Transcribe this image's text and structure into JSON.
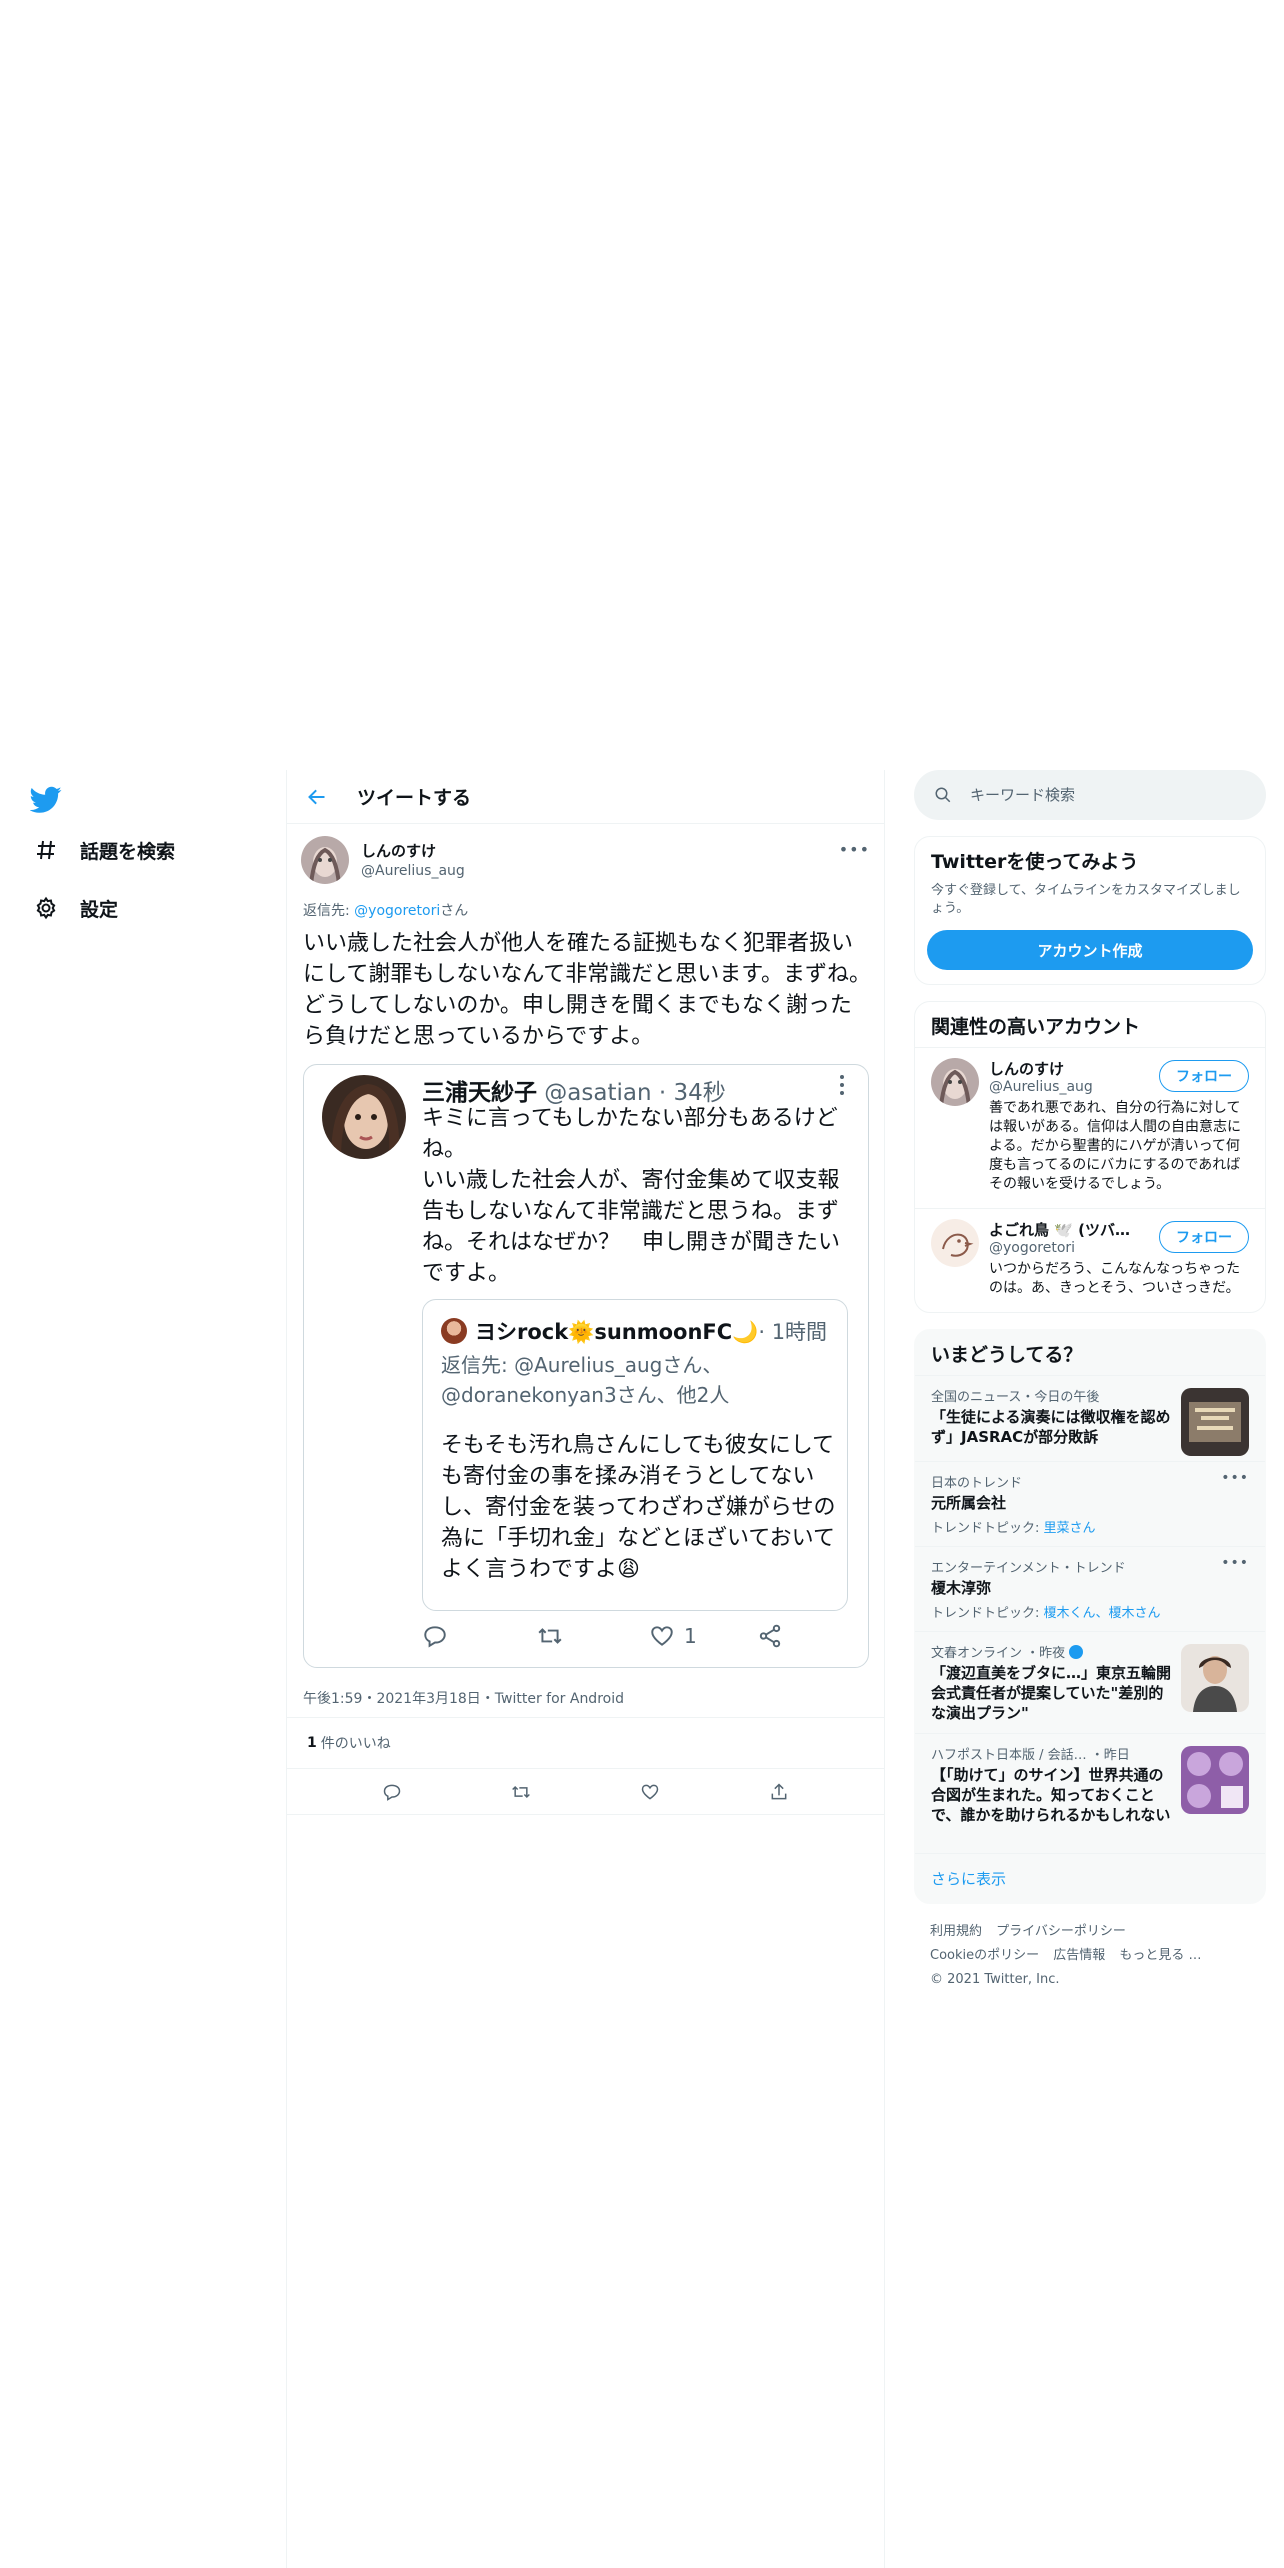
{
  "nav": {
    "items": [
      {
        "label": "話題を検索",
        "icon": "hashtag-icon"
      },
      {
        "label": "設定",
        "icon": "gear-icon"
      }
    ]
  },
  "header": {
    "title": "ツイートする"
  },
  "tweet": {
    "author_name": "しんのすけ",
    "author_handle": "@Aurelius_aug",
    "reply_prefix": "返信先: ",
    "reply_handle": "@yogoretori",
    "reply_suffix": "さん",
    "text": "いい歳した社会人が他人を確たる証拠もなく犯罪者扱いにして謝罪もしないなんて非常識だと思います。まずね。どうしてしないのか。申し開きを聞くまでもなく謝ったら負けだと思っているからですよ。",
    "meta": "午後1:59・2021年3月18日・Twitter for Android",
    "likes_count": "1",
    "likes_label": "件のいいね"
  },
  "embedded": {
    "name": "三浦天紗子",
    "handle_time": " @asatian · 34秒",
    "text": "キミに言ってもしかたない部分もあるけどね。\nいい歳した社会人が、寄付金集めて収支報告もしないなんて非常識だと思うね。まずね。それはなぜか？　申し開きが聞きたいですよ。",
    "like_count": "1",
    "quoted": {
      "name": "ヨシrock🌞sunmoonFC🌙",
      "time": "· 1時間",
      "reply_to": "返信先: @Aurelius_augさん、@doranekonyan3さん、他2人",
      "text": "そもそも汚れ鳥さんにしても彼女にしても寄付金の事を揉み消そうとしてないし、寄付金を装ってわざわざ嫌がらせの為に「手切れ金」などとほざいておいてよく言うわですよ😩"
    }
  },
  "search": {
    "placeholder": "キーワード検索"
  },
  "cta": {
    "title": "Twitterを使ってみよう",
    "desc": "今すぐ登録して、タイムラインをカスタマイズしましょう。",
    "button": "アカウント作成"
  },
  "related": {
    "title": "関連性の高いアカウント",
    "follow_label": "フォロー",
    "accounts": [
      {
        "name": "しんのすけ",
        "handle": "@Aurelius_aug",
        "bio": "善であれ悪であれ、自分の行為に対しては報いがある。信仰は人間の自由意志による。だから聖書的にハゲが清いって何度も言ってるのにバカにするのであればその報いを受けるでしょう。"
      },
      {
        "name": "よごれ鳥 🕊️ (ツバ…",
        "handle": "@yogoretori",
        "bio": "いつからだろう、こんなんなっちゃったのは。あ、きっとそう、ついさっきだ。"
      }
    ]
  },
  "trends": {
    "title": "いまどうしてる？",
    "items": [
      {
        "category": "全国のニュース・今日の午後",
        "title": "「生徒による演奏には徴収権を認めず」JASRACが部分敗訴",
        "sub_prefix": "",
        "sub_links": ""
      },
      {
        "category": "日本のトレンド",
        "title": "元所属会社",
        "sub_prefix": "トレンドトピック: ",
        "sub_links": "里菜さん"
      },
      {
        "category": "エンターテインメント・トレンド",
        "title": "榎木淳弥",
        "sub_prefix": "トレンドトピック: ",
        "sub_links": "榎木くん、榎木さん"
      },
      {
        "category": "文春オンライン ・昨夜",
        "title": "「渡辺直美をブタに…」東京五輪開会式責任者が提案していた\"差別的な演出プラン\"",
        "sub_prefix": "",
        "sub_links": ""
      },
      {
        "category": "ハフポスト日本版 / 会話… ・昨日",
        "title": "【「助けて」のサイン】世界共通の合図が生まれた。知っておくことで、誰かを助けられるかもしれない",
        "sub_prefix": "",
        "sub_links": ""
      }
    ],
    "show_more": "さらに表示"
  },
  "footer": {
    "links": [
      "利用規約",
      "プライバシーポリシー",
      "Cookieのポリシー",
      "広告情報",
      "もっと見る …"
    ],
    "copyright": "© 2021 Twitter, Inc."
  },
  "colors": {
    "accent": "#1d9bf0",
    "text": "#0f1419",
    "muted": "#536471",
    "border": "#eff3f4"
  }
}
